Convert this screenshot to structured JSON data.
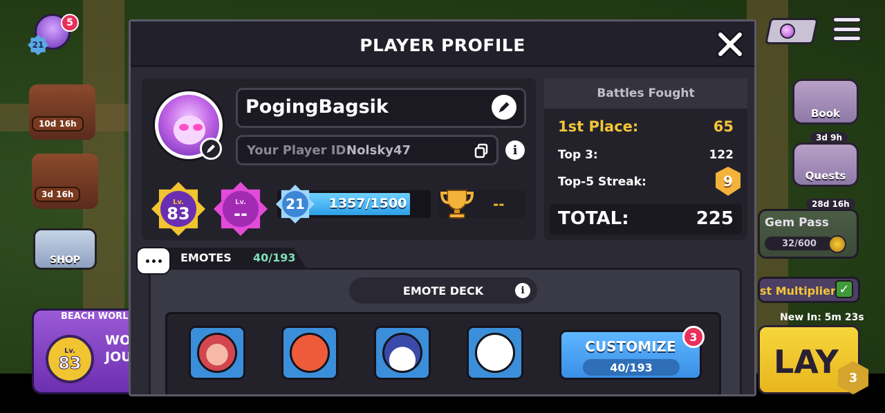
{
  "hud": {
    "notif_count": "5",
    "player_level": "21",
    "event1_timer": "10d 16h",
    "event2_timer": "3d 16h",
    "shop_label": "SHOP",
    "book_label": "Book",
    "quests_label": "Quests",
    "quests_timer": "3d 9h",
    "gem_pass_timer": "28d 16h",
    "gem_pass_label": "Gem Pass",
    "gem_pass_progress": "32/600",
    "multiplier_label": "st Multiplier",
    "new_in": "New In: 5m 23s",
    "play_label": "LAY",
    "play_badge": "3",
    "beach_world_label": "BEACH WORLD",
    "beach_world_level_label": "Lv.",
    "beach_world_level": "83",
    "beach_world_text_1": "WO",
    "beach_world_text_2": "JOU"
  },
  "modal": {
    "title": "PLAYER PROFILE",
    "player_name": "PogingBagsik",
    "player_id_label": "Your Player ID:",
    "player_id": "Nolsky47",
    "level_badge": {
      "label": "Lv.",
      "value": "83"
    },
    "level_badge_2": {
      "label": "Lv.",
      "value": "--"
    },
    "xp_level": "21",
    "xp_current": 1357,
    "xp_max": 1500,
    "xp_text": "1357/1500",
    "trophies": "--"
  },
  "battles": {
    "heading": "Battles Fought",
    "first_place_label": "1st Place:",
    "first_place_value": "65",
    "top3_label": "Top 3:",
    "top3_value": "122",
    "streak_label": "Top-5 Streak:",
    "streak_value": "9",
    "total_label": "TOTAL:",
    "total_value": "225"
  },
  "emotes": {
    "tab_label": "EMOTES",
    "tab_count": "40/193",
    "deck_label": "EMOTE DECK",
    "slots": [
      "monkey-emote",
      "angry-emote",
      "scared-emote",
      "crying-emote"
    ],
    "customize_label": "CUSTOMIZE",
    "customize_count": "40/193",
    "customize_badge": "3"
  },
  "colors": {
    "accent_gold": "#f3c637",
    "accent_blue": "#3a8fe6",
    "panel_dark": "#23222b"
  }
}
